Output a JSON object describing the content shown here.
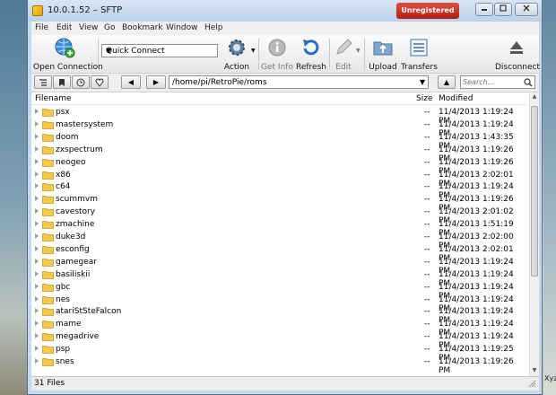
{
  "window": {
    "title": "10.0.1.52 – SFTP",
    "unregistered": "Unregistered"
  },
  "desktop": {
    "corner_text": "Xyz"
  },
  "menu": [
    "File",
    "Edit",
    "View",
    "Go",
    "Bookmark",
    "Window",
    "Help"
  ],
  "toolbar": {
    "open_connection": "Open Connection",
    "quick_connect": "Quick Connect",
    "action": "Action",
    "get_info": "Get Info",
    "refresh": "Refresh",
    "edit": "Edit",
    "upload": "Upload",
    "transfers": "Transfers",
    "disconnect": "Disconnect"
  },
  "path": {
    "current": "/home/pi/RetroPie/roms",
    "search_placeholder": "Search..."
  },
  "columns": {
    "filename": "Filename",
    "size": "Size",
    "modified": "Modified"
  },
  "files": [
    {
      "name": "psx",
      "size": "--",
      "modified": "11/4/2013 1:19:24 PM"
    },
    {
      "name": "mastersystem",
      "size": "--",
      "modified": "11/4/2013 1:19:24 PM"
    },
    {
      "name": "doom",
      "size": "--",
      "modified": "11/4/2013 1:43:35 PM"
    },
    {
      "name": "zxspectrum",
      "size": "--",
      "modified": "11/4/2013 1:19:26 PM"
    },
    {
      "name": "neogeo",
      "size": "--",
      "modified": "11/4/2013 1:19:26 PM"
    },
    {
      "name": "x86",
      "size": "--",
      "modified": "11/4/2013 2:02:01 PM"
    },
    {
      "name": "c64",
      "size": "--",
      "modified": "11/4/2013 1:19:24 PM"
    },
    {
      "name": "scummvm",
      "size": "--",
      "modified": "11/4/2013 1:19:26 PM"
    },
    {
      "name": "cavestory",
      "size": "--",
      "modified": "11/4/2013 2:01:02 PM"
    },
    {
      "name": "zmachine",
      "size": "--",
      "modified": "11/4/2013 1:51:19 PM"
    },
    {
      "name": "duke3d",
      "size": "--",
      "modified": "11/4/2013 2:02:00 PM"
    },
    {
      "name": "esconfig",
      "size": "--",
      "modified": "11/4/2013 2:02:01 PM"
    },
    {
      "name": "gamegear",
      "size": "--",
      "modified": "11/4/2013 1:19:24 PM"
    },
    {
      "name": "basiliskii",
      "size": "--",
      "modified": "11/4/2013 1:19:24 PM"
    },
    {
      "name": "gbc",
      "size": "--",
      "modified": "11/4/2013 1:19:24 PM"
    },
    {
      "name": "nes",
      "size": "--",
      "modified": "11/4/2013 1:19:24 PM"
    },
    {
      "name": "atariStSteFalcon",
      "size": "--",
      "modified": "11/4/2013 1:19:24 PM"
    },
    {
      "name": "mame",
      "size": "--",
      "modified": "11/4/2013 1:19:24 PM"
    },
    {
      "name": "megadrive",
      "size": "--",
      "modified": "11/4/2013 1:19:24 PM"
    },
    {
      "name": "psp",
      "size": "--",
      "modified": "11/4/2013 1:19:25 PM"
    },
    {
      "name": "snes",
      "size": "--",
      "modified": "11/4/2013 1:19:26 PM"
    }
  ],
  "status": {
    "count": "31 Files"
  },
  "colors": {
    "folder": "#f2c94c",
    "titlebar": "#c6d9ec",
    "unregistered": "#c4281a"
  }
}
